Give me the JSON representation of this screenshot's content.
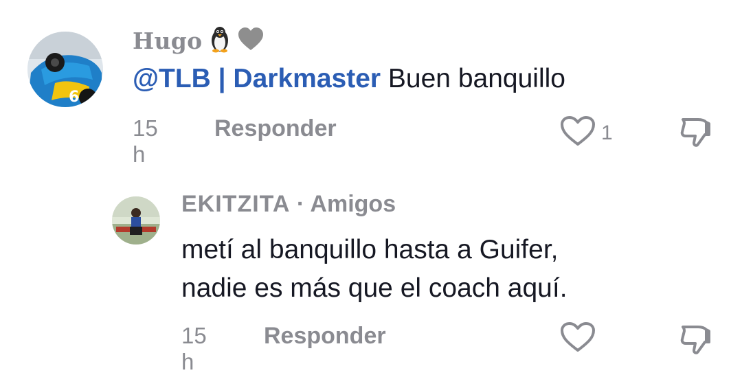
{
  "comments": [
    {
      "username": "Hugo",
      "username_emoji": [
        "penguin-icon",
        "grey-heart-icon"
      ],
      "mention": "@TLB | Darkmaster",
      "text": "Buen banquillo",
      "time": "15 h",
      "reply_label": "Responder",
      "like_count": "1"
    },
    {
      "username": "EKITZITA",
      "badge": "· Amigos",
      "text_lines": [
        "metí al banquillo hasta a Guifer,",
        "nadie es más que el coach aquí."
      ],
      "time": "15 h",
      "reply_label": "Responder"
    }
  ],
  "colors": {
    "mention": "#2b5db4",
    "secondary_text": "#8a8b91",
    "primary_text": "#161823"
  }
}
